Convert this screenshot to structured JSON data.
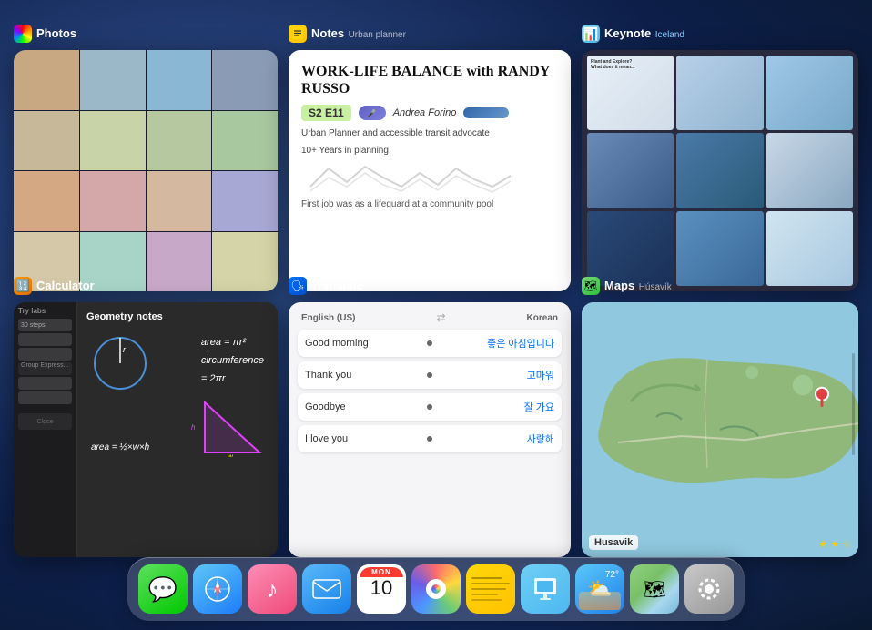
{
  "apps": {
    "photos": {
      "name": "Photos",
      "subtitle": "",
      "icon_color": "#fff",
      "icon_bg": "rainbow"
    },
    "notes": {
      "name": "Notes",
      "subtitle": "Urban planner",
      "icon_color": "#fff",
      "icon_bg": "#ffd60a",
      "content": {
        "title": "WORK-LIFE BALANCE with RANDY RUSSO",
        "season": "S2 E11",
        "person": "Andrea Forino",
        "desc": "Urban Planner and accessible transit advocate",
        "years": "10+ Years in planning",
        "first_job": "First job was as a lifeguard at a community pool"
      }
    },
    "keynote": {
      "name": "Keynote",
      "subtitle": "Iceland",
      "icon_color": "#fff",
      "icon_bg": "#4db8f0"
    },
    "calculator": {
      "name": "Calculator",
      "subtitle": "",
      "icon_color": "#fff",
      "icon_bg": "#ff9500",
      "content": {
        "title": "Geometry notes",
        "formula1": "area = πr²",
        "formula2": "circumference",
        "formula3": "= 2πr",
        "formula4": "area = ½×w×h"
      }
    },
    "translate": {
      "name": "Translate",
      "subtitle": "",
      "icon_color": "#fff",
      "icon_bg": "#0070ff",
      "content": {
        "lang_from": "English (US)",
        "lang_to": "Korean",
        "pairs": [
          {
            "en": "Good morning",
            "kr": "좋은 아침입니다"
          },
          {
            "en": "Thank you",
            "kr": "고마워"
          },
          {
            "en": "Goodbye",
            "kr": "잘 가요"
          },
          {
            "en": "I love you",
            "kr": "사랑해"
          }
        ]
      }
    },
    "maps": {
      "name": "Maps",
      "subtitle": "Húsavík",
      "icon_color": "#fff",
      "icon_bg": "#2ecc40",
      "content": {
        "location": "Husavik",
        "stars": "★ ★ ☆"
      }
    }
  },
  "dock": {
    "items": [
      {
        "id": "messages",
        "label": "Messages",
        "icon": "💬",
        "type": "colored",
        "bg": "linear-gradient(145deg,#5de05d,#00c800)"
      },
      {
        "id": "safari",
        "label": "Safari",
        "icon": "🧭",
        "type": "colored",
        "bg": "linear-gradient(145deg,#5ec6f7,#1d7cf9)"
      },
      {
        "id": "music",
        "label": "Music",
        "icon": "♪",
        "type": "colored",
        "bg": "linear-gradient(145deg,#fc8eb5,#f04a7a)"
      },
      {
        "id": "mail",
        "label": "Mail",
        "icon": "✉",
        "type": "colored",
        "bg": "linear-gradient(145deg,#5ab8fa,#1580e8)"
      },
      {
        "id": "calendar",
        "label": "Calendar",
        "type": "calendar",
        "day_name": "MON",
        "day_num": "10"
      },
      {
        "id": "photos",
        "label": "Photos",
        "type": "photos"
      },
      {
        "id": "notes",
        "label": "Notes",
        "type": "notes"
      },
      {
        "id": "keynote",
        "label": "Keynote",
        "icon": "📊",
        "type": "colored",
        "bg": "linear-gradient(145deg,#6fcff5,#4db8f0)"
      },
      {
        "id": "weather",
        "label": "Weather",
        "icon": "⛅",
        "type": "colored",
        "bg": "linear-gradient(145deg,#5ac8fa,#2080e8)"
      },
      {
        "id": "maps",
        "label": "Maps",
        "icon": "🗺",
        "type": "colored",
        "bg": "linear-gradient(145deg,#78d672,#2ecc40)"
      },
      {
        "id": "settings",
        "label": "Settings",
        "icon": "⚙",
        "type": "colored",
        "bg": "linear-gradient(145deg,#c8c8c8,#999)"
      }
    ]
  }
}
